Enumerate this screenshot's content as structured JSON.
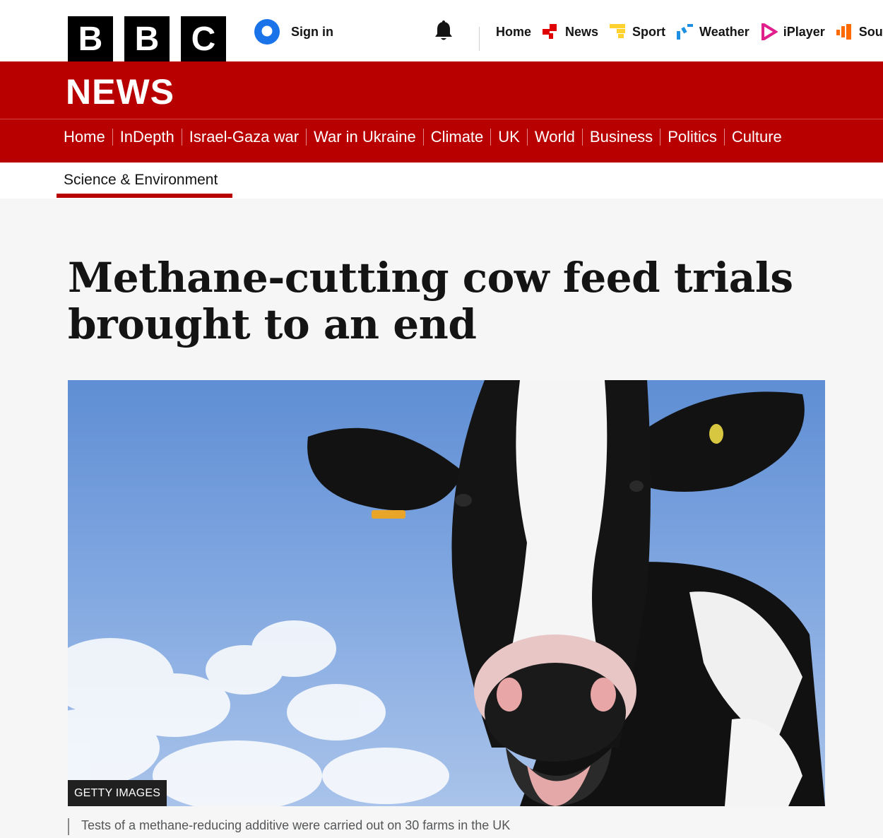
{
  "header": {
    "logo_letters": [
      "B",
      "B",
      "C"
    ],
    "signin_label": "Sign in",
    "nav": [
      {
        "label": "Home",
        "icon": ""
      },
      {
        "label": "News",
        "icon": "news-icon",
        "color": "#e00000"
      },
      {
        "label": "Sport",
        "icon": "sport-icon",
        "color": "#ffd230"
      },
      {
        "label": "Weather",
        "icon": "weather-icon",
        "color": "#1c8fe3"
      },
      {
        "label": "iPlayer",
        "icon": "iplayer-icon",
        "color": "#e01e8c"
      },
      {
        "label": "Sounds",
        "icon": "sounds-icon",
        "color": "#ff6a00"
      }
    ]
  },
  "banner": {
    "title": "NEWS",
    "color": "#b80000"
  },
  "sections": [
    "Home",
    "InDepth",
    "Israel-Gaza war",
    "War in Ukraine",
    "Climate",
    "UK",
    "World",
    "Business",
    "Politics",
    "Culture"
  ],
  "subnav": {
    "active": "Science & Environment"
  },
  "article": {
    "headline": "Methane-cutting cow feed trials brought to an end",
    "image_credit": "GETTY IMAGES",
    "caption": "Tests of a methane-reducing additive were carried out on 30 farms in the UK"
  }
}
